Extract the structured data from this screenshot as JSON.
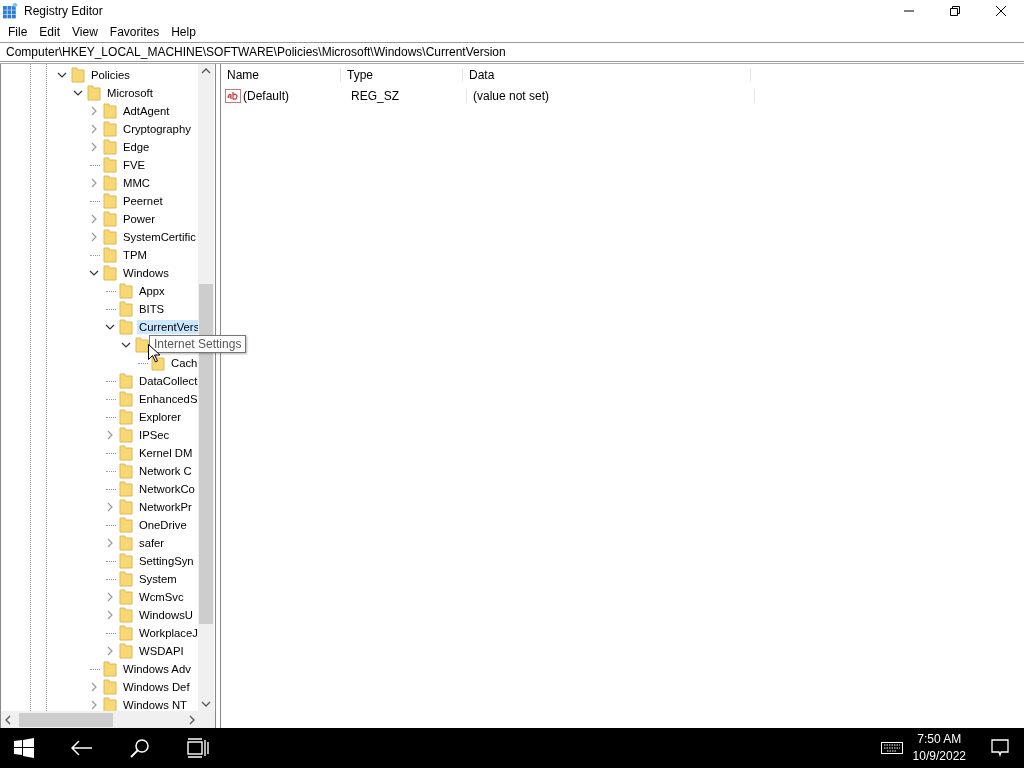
{
  "window": {
    "title": "Registry Editor"
  },
  "menu": [
    "File",
    "Edit",
    "View",
    "Favorites",
    "Help"
  ],
  "address": "Computer\\HKEY_LOCAL_MACHINE\\SOFTWARE\\Policies\\Microsoft\\Windows\\CurrentVersion",
  "tree": [
    {
      "label": "Policies",
      "kind": "branch",
      "expanded": true,
      "selected": false,
      "children": [
        {
          "label": "Microsoft",
          "kind": "branch",
          "expanded": true,
          "selected": false,
          "children": [
            {
              "label": "AdtAgent",
              "kind": "branch",
              "expanded": false,
              "selected": false
            },
            {
              "label": "Cryptography",
              "kind": "branch",
              "expanded": false,
              "selected": false
            },
            {
              "label": "Edge",
              "kind": "branch",
              "expanded": false,
              "selected": false
            },
            {
              "label": "FVE",
              "kind": "leaf",
              "selected": false
            },
            {
              "label": "MMC",
              "kind": "branch",
              "expanded": false,
              "selected": false
            },
            {
              "label": "Peernet",
              "kind": "leaf",
              "selected": false
            },
            {
              "label": "Power",
              "kind": "branch",
              "expanded": false,
              "selected": false
            },
            {
              "label": "SystemCertific",
              "kind": "branch",
              "expanded": false,
              "selected": false
            },
            {
              "label": "TPM",
              "kind": "leaf",
              "selected": false
            },
            {
              "label": "Windows",
              "kind": "branch",
              "expanded": true,
              "selected": false,
              "children": [
                {
                  "label": "Appx",
                  "kind": "leaf",
                  "selected": false
                },
                {
                  "label": "BITS",
                  "kind": "leaf",
                  "selected": false
                },
                {
                  "label": "CurrentVers",
                  "kind": "branch",
                  "expanded": true,
                  "selected": true,
                  "children": [
                    {
                      "kind": "branch",
                      "expanded": true,
                      "children": [
                        {
                          "label": "Cach",
                          "kind": "leaf",
                          "selected": false
                        }
                      ]
                    }
                  ]
                },
                {
                  "label": "DataCollect",
                  "kind": "leaf",
                  "selected": false
                },
                {
                  "label": "EnhancedS",
                  "kind": "leaf",
                  "selected": false
                },
                {
                  "label": "Explorer",
                  "kind": "leaf",
                  "selected": false
                },
                {
                  "label": "IPSec",
                  "kind": "branch",
                  "expanded": false,
                  "selected": false
                },
                {
                  "label": "Kernel DM",
                  "kind": "leaf",
                  "selected": false
                },
                {
                  "label": "Network C",
                  "kind": "leaf",
                  "selected": false
                },
                {
                  "label": "NetworkCo",
                  "kind": "leaf",
                  "selected": false
                },
                {
                  "label": "NetworkPr",
                  "kind": "branch",
                  "expanded": false,
                  "selected": false
                },
                {
                  "label": "OneDrive",
                  "kind": "leaf",
                  "selected": false
                },
                {
                  "label": "safer",
                  "kind": "branch",
                  "expanded": false,
                  "selected": false
                },
                {
                  "label": "SettingSyn",
                  "kind": "leaf",
                  "selected": false
                },
                {
                  "label": "System",
                  "kind": "leaf",
                  "selected": false
                },
                {
                  "label": "WcmSvc",
                  "kind": "branch",
                  "expanded": false,
                  "selected": false
                },
                {
                  "label": "WindowsU",
                  "kind": "branch",
                  "expanded": false,
                  "selected": false
                },
                {
                  "label": "WorkplaceJ",
                  "kind": "leaf",
                  "selected": false
                },
                {
                  "label": "WSDAPI",
                  "kind": "branch",
                  "expanded": false,
                  "selected": false
                }
              ]
            },
            {
              "label": "Windows Adv",
              "kind": "leaf",
              "selected": false
            },
            {
              "label": "Windows Def",
              "kind": "branch",
              "expanded": false,
              "selected": false
            },
            {
              "label": "Windows NT",
              "kind": "branch",
              "expanded": false,
              "selected": false
            }
          ]
        }
      ]
    }
  ],
  "tooltip": "Internet Settings",
  "table": {
    "columns": [
      "Name",
      "Type",
      "Data"
    ],
    "rows": [
      {
        "name": "(Default)",
        "type": "REG_SZ",
        "data": "(value not set)"
      }
    ]
  },
  "taskbar": {
    "time": "7:50 AM",
    "date": "10/9/2022"
  }
}
